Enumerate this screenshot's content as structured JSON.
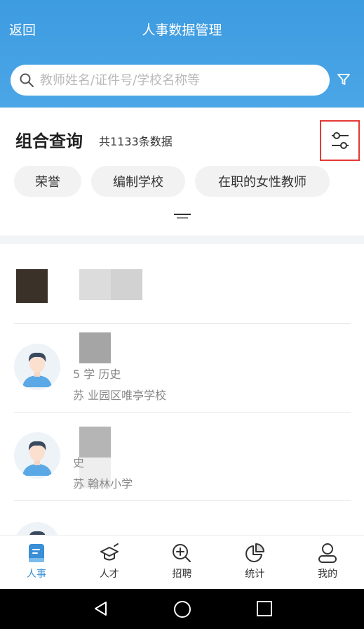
{
  "header": {
    "back_label": "返回",
    "title": "人事数据管理",
    "search_placeholder": "教师姓名/证件号/学校名称等"
  },
  "query": {
    "title": "组合查询",
    "count_text": "共1133条数据",
    "chips": [
      "荣誉",
      "编制学校",
      "在职的女性教师"
    ]
  },
  "list": {
    "items": [
      {
        "line1": "",
        "line2": ""
      },
      {
        "line1": "5  学  历史",
        "line2": "苏  业园区唯亭学校"
      },
      {
        "line1": "    史",
        "line2": "苏  翰林小学"
      },
      {
        "line1": "",
        "line2": ""
      }
    ]
  },
  "tabbar": {
    "tabs": [
      {
        "label": "人事",
        "icon": "personnel-book-icon",
        "active": true
      },
      {
        "label": "人才",
        "icon": "talent-mortarboard-icon",
        "active": false
      },
      {
        "label": "招聘",
        "icon": "recruit-search-plus-icon",
        "active": false
      },
      {
        "label": "统计",
        "icon": "statistics-pie-icon",
        "active": false
      },
      {
        "label": "我的",
        "icon": "profile-user-icon",
        "active": false
      }
    ]
  },
  "colors": {
    "header_blue": "#4ba6e6",
    "active_tab": "#3a8fd6",
    "highlight_red": "#e53935"
  }
}
